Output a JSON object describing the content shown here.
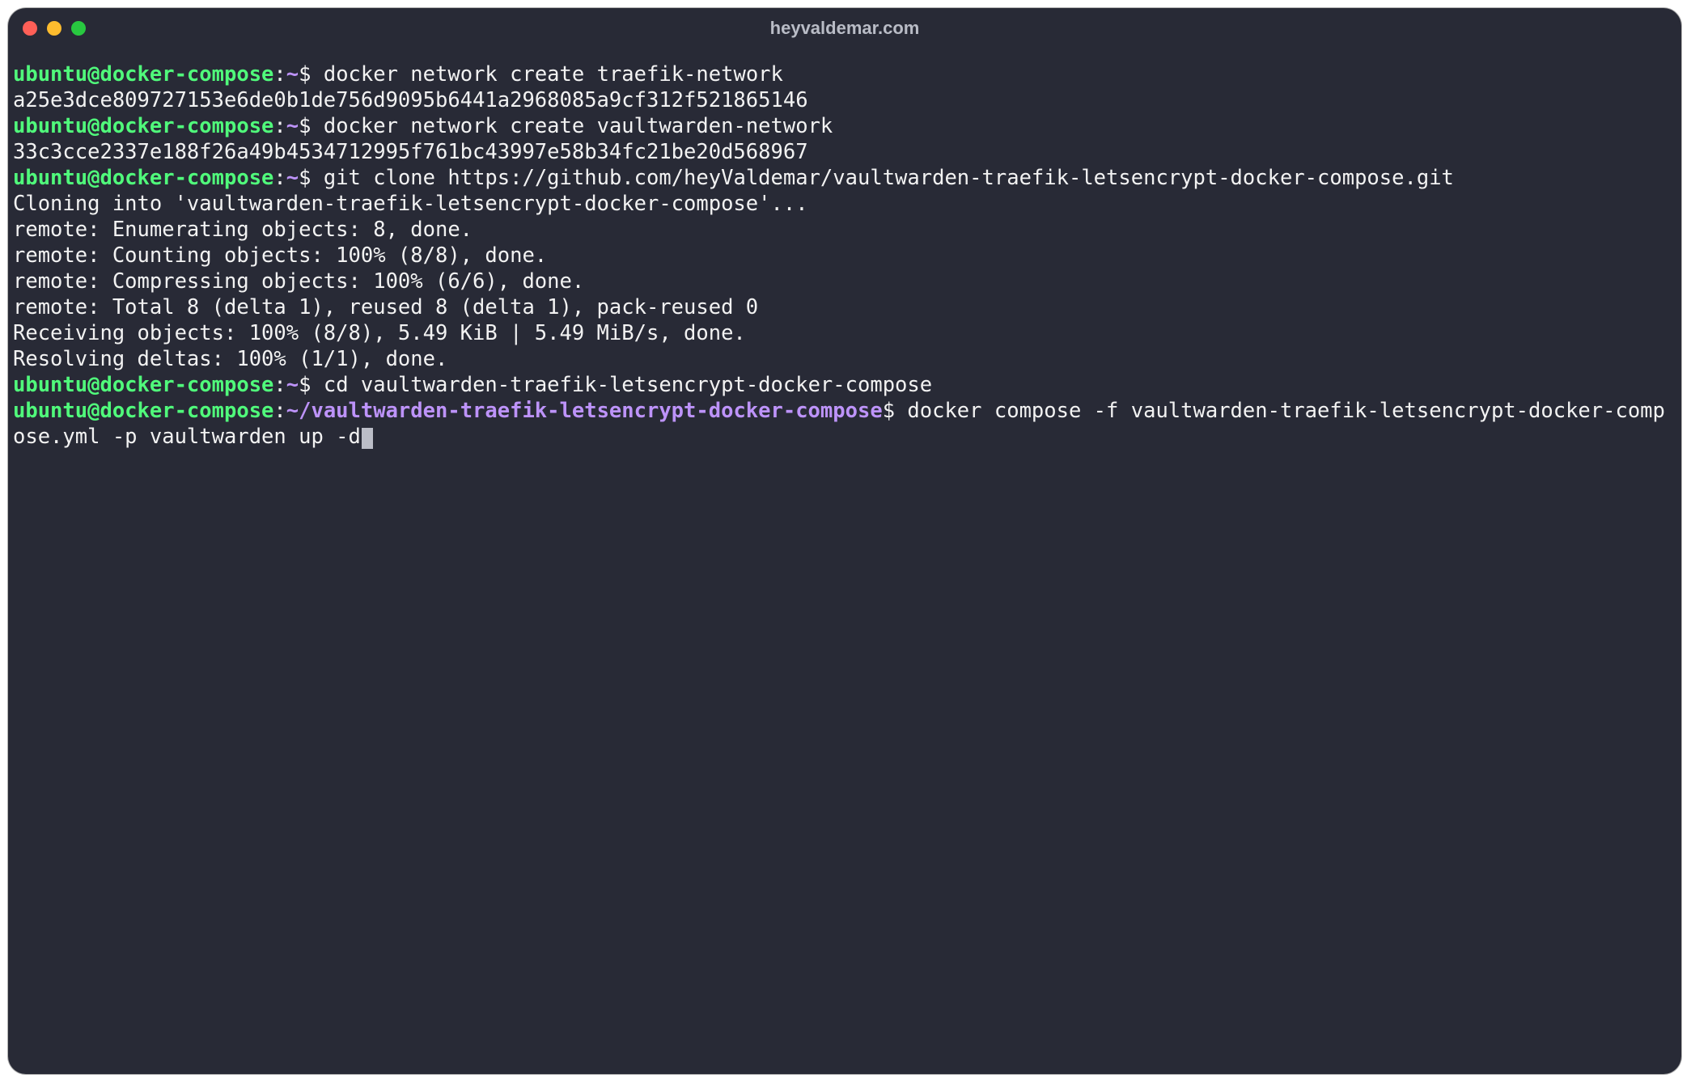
{
  "title": "heyvaldemar.com",
  "prompt": {
    "user_host": "ubuntu@docker-compose",
    "home_path": "~",
    "deep_path": "~/vaultwarden-traefik-letsencrypt-docker-compose",
    "sep1": ":",
    "dollar": "$"
  },
  "lines": {
    "cmd1": " docker network create traefik-network",
    "out1": "a25e3dce809727153e6de0b1de756d9095b6441a2968085a9cf312f521865146",
    "cmd2": " docker network create vaultwarden-network",
    "out2": "33c3cce2337e188f26a49b4534712995f761bc43997e58b34fc21be20d568967",
    "cmd3": " git clone https://github.com/heyValdemar/vaultwarden-traefik-letsencrypt-docker-compose.git",
    "out3a": "Cloning into 'vaultwarden-traefik-letsencrypt-docker-compose'...",
    "out3b": "remote: Enumerating objects: 8, done.",
    "out3c": "remote: Counting objects: 100% (8/8), done.",
    "out3d": "remote: Compressing objects: 100% (6/6), done.",
    "out3e": "remote: Total 8 (delta 1), reused 8 (delta 1), pack-reused 0",
    "out3f": "Receiving objects: 100% (8/8), 5.49 KiB | 5.49 MiB/s, done.",
    "out3g": "Resolving deltas: 100% (1/1), done.",
    "cmd4": " cd vaultwarden-traefik-letsencrypt-docker-compose",
    "cmd5": " docker compose -f vaultwarden-traefik-letsencrypt-docker-compose.yml -p vaultwarden up -d"
  }
}
